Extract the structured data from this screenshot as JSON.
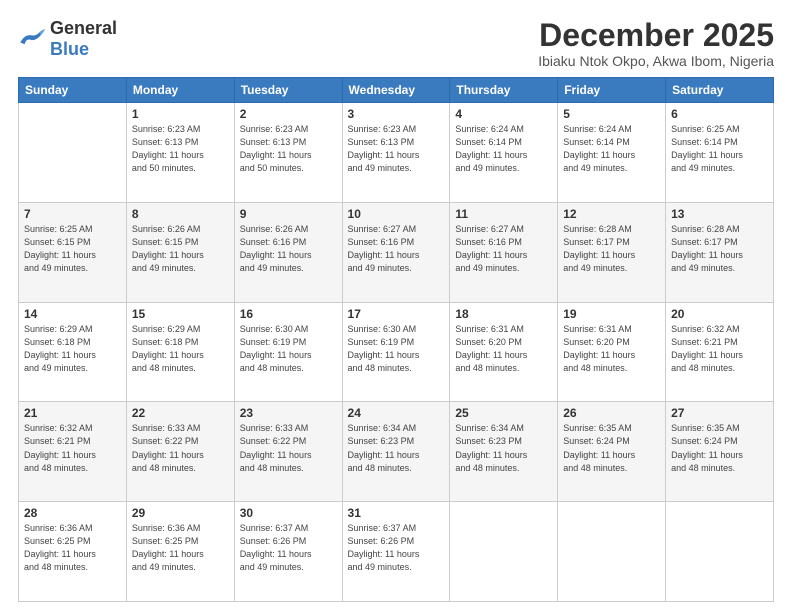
{
  "header": {
    "logo_general": "General",
    "logo_blue": "Blue",
    "month": "December 2025",
    "location": "Ibiaku Ntok Okpo, Akwa Ibom, Nigeria"
  },
  "days_of_week": [
    "Sunday",
    "Monday",
    "Tuesday",
    "Wednesday",
    "Thursday",
    "Friday",
    "Saturday"
  ],
  "weeks": [
    [
      {
        "day": "",
        "info": ""
      },
      {
        "day": "1",
        "info": "Sunrise: 6:23 AM\nSunset: 6:13 PM\nDaylight: 11 hours\nand 50 minutes."
      },
      {
        "day": "2",
        "info": "Sunrise: 6:23 AM\nSunset: 6:13 PM\nDaylight: 11 hours\nand 50 minutes."
      },
      {
        "day": "3",
        "info": "Sunrise: 6:23 AM\nSunset: 6:13 PM\nDaylight: 11 hours\nand 49 minutes."
      },
      {
        "day": "4",
        "info": "Sunrise: 6:24 AM\nSunset: 6:14 PM\nDaylight: 11 hours\nand 49 minutes."
      },
      {
        "day": "5",
        "info": "Sunrise: 6:24 AM\nSunset: 6:14 PM\nDaylight: 11 hours\nand 49 minutes."
      },
      {
        "day": "6",
        "info": "Sunrise: 6:25 AM\nSunset: 6:14 PM\nDaylight: 11 hours\nand 49 minutes."
      }
    ],
    [
      {
        "day": "7",
        "info": "Sunrise: 6:25 AM\nSunset: 6:15 PM\nDaylight: 11 hours\nand 49 minutes."
      },
      {
        "day": "8",
        "info": "Sunrise: 6:26 AM\nSunset: 6:15 PM\nDaylight: 11 hours\nand 49 minutes."
      },
      {
        "day": "9",
        "info": "Sunrise: 6:26 AM\nSunset: 6:16 PM\nDaylight: 11 hours\nand 49 minutes."
      },
      {
        "day": "10",
        "info": "Sunrise: 6:27 AM\nSunset: 6:16 PM\nDaylight: 11 hours\nand 49 minutes."
      },
      {
        "day": "11",
        "info": "Sunrise: 6:27 AM\nSunset: 6:16 PM\nDaylight: 11 hours\nand 49 minutes."
      },
      {
        "day": "12",
        "info": "Sunrise: 6:28 AM\nSunset: 6:17 PM\nDaylight: 11 hours\nand 49 minutes."
      },
      {
        "day": "13",
        "info": "Sunrise: 6:28 AM\nSunset: 6:17 PM\nDaylight: 11 hours\nand 49 minutes."
      }
    ],
    [
      {
        "day": "14",
        "info": "Sunrise: 6:29 AM\nSunset: 6:18 PM\nDaylight: 11 hours\nand 49 minutes."
      },
      {
        "day": "15",
        "info": "Sunrise: 6:29 AM\nSunset: 6:18 PM\nDaylight: 11 hours\nand 48 minutes."
      },
      {
        "day": "16",
        "info": "Sunrise: 6:30 AM\nSunset: 6:19 PM\nDaylight: 11 hours\nand 48 minutes."
      },
      {
        "day": "17",
        "info": "Sunrise: 6:30 AM\nSunset: 6:19 PM\nDaylight: 11 hours\nand 48 minutes."
      },
      {
        "day": "18",
        "info": "Sunrise: 6:31 AM\nSunset: 6:20 PM\nDaylight: 11 hours\nand 48 minutes."
      },
      {
        "day": "19",
        "info": "Sunrise: 6:31 AM\nSunset: 6:20 PM\nDaylight: 11 hours\nand 48 minutes."
      },
      {
        "day": "20",
        "info": "Sunrise: 6:32 AM\nSunset: 6:21 PM\nDaylight: 11 hours\nand 48 minutes."
      }
    ],
    [
      {
        "day": "21",
        "info": "Sunrise: 6:32 AM\nSunset: 6:21 PM\nDaylight: 11 hours\nand 48 minutes."
      },
      {
        "day": "22",
        "info": "Sunrise: 6:33 AM\nSunset: 6:22 PM\nDaylight: 11 hours\nand 48 minutes."
      },
      {
        "day": "23",
        "info": "Sunrise: 6:33 AM\nSunset: 6:22 PM\nDaylight: 11 hours\nand 48 minutes."
      },
      {
        "day": "24",
        "info": "Sunrise: 6:34 AM\nSunset: 6:23 PM\nDaylight: 11 hours\nand 48 minutes."
      },
      {
        "day": "25",
        "info": "Sunrise: 6:34 AM\nSunset: 6:23 PM\nDaylight: 11 hours\nand 48 minutes."
      },
      {
        "day": "26",
        "info": "Sunrise: 6:35 AM\nSunset: 6:24 PM\nDaylight: 11 hours\nand 48 minutes."
      },
      {
        "day": "27",
        "info": "Sunrise: 6:35 AM\nSunset: 6:24 PM\nDaylight: 11 hours\nand 48 minutes."
      }
    ],
    [
      {
        "day": "28",
        "info": "Sunrise: 6:36 AM\nSunset: 6:25 PM\nDaylight: 11 hours\nand 48 minutes."
      },
      {
        "day": "29",
        "info": "Sunrise: 6:36 AM\nSunset: 6:25 PM\nDaylight: 11 hours\nand 49 minutes."
      },
      {
        "day": "30",
        "info": "Sunrise: 6:37 AM\nSunset: 6:26 PM\nDaylight: 11 hours\nand 49 minutes."
      },
      {
        "day": "31",
        "info": "Sunrise: 6:37 AM\nSunset: 6:26 PM\nDaylight: 11 hours\nand 49 minutes."
      },
      {
        "day": "",
        "info": ""
      },
      {
        "day": "",
        "info": ""
      },
      {
        "day": "",
        "info": ""
      }
    ]
  ]
}
